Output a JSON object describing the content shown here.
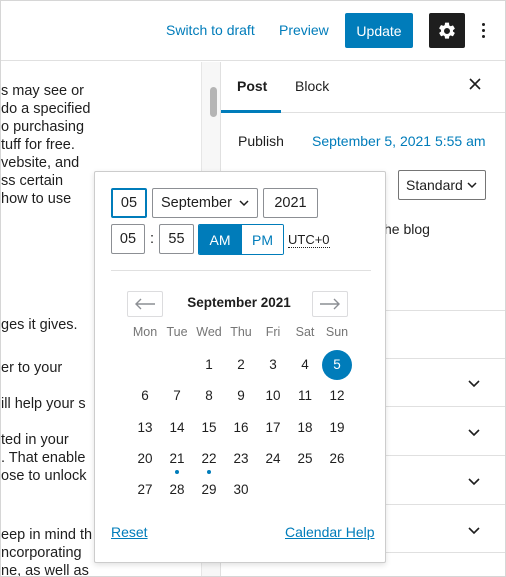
{
  "toolbar": {
    "switch_to_draft": "Switch to draft",
    "preview": "Preview",
    "update": "Update",
    "settings_icon": "gear-icon",
    "more_icon": "more-vertical-icon"
  },
  "editor": {
    "lines": [
      "s may see or",
      "do a specified",
      "o purchasing",
      "tuff for free.",
      "vebsite, and",
      "ss certain",
      " how to use",
      "ges it gives.",
      "er to your",
      "ill help your s",
      "ted in your",
      ". That enable",
      "ose to unlock",
      "eep in mind th",
      "ncorporating",
      "ne, as well as"
    ]
  },
  "sidebar": {
    "tabs": [
      {
        "label": "Post",
        "active": true
      },
      {
        "label": "Block",
        "active": false
      }
    ],
    "close_icon": "close-icon",
    "publish_label": "Publish",
    "publish_date": "September 5, 2021 5:55 am",
    "format_value": "Standard",
    "stick_text_fragment": "he blog"
  },
  "datepicker": {
    "day": "05",
    "month": "September",
    "year": "2021",
    "hour": "05",
    "minute": "55",
    "colon": ":",
    "am": "AM",
    "pm": "PM",
    "period_selected": "AM",
    "timezone": "UTC+0",
    "calendar_title": "September 2021",
    "weekdays": [
      "Mon",
      "Tue",
      "Wed",
      "Thu",
      "Fri",
      "Sat",
      "Sun"
    ],
    "days": [
      "1",
      "2",
      "3",
      "4",
      "5",
      "6",
      "7",
      "8",
      "9",
      "10",
      "11",
      "12",
      "13",
      "14",
      "15",
      "16",
      "17",
      "18",
      "19",
      "20",
      "21",
      "22",
      "23",
      "24",
      "25",
      "26",
      "27",
      "28",
      "29",
      "30"
    ],
    "selected_day": "5",
    "days_with_posts": [
      "21",
      "22"
    ],
    "reset": "Reset",
    "calendar_help": "Calendar Help"
  },
  "colors": {
    "accent": "#007cba",
    "text": "#1e1e1e",
    "muted": "#757575"
  }
}
